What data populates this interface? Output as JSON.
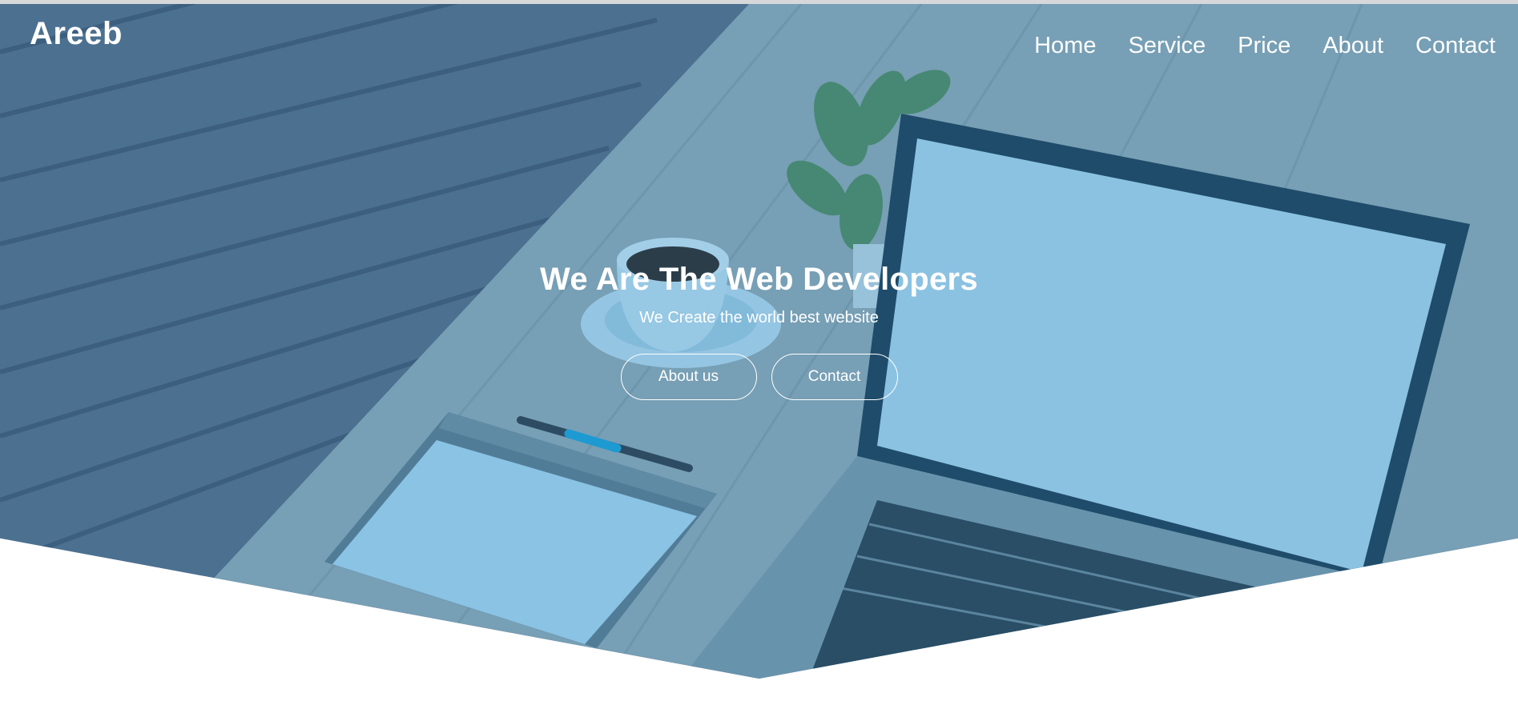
{
  "brand": {
    "logo_text": "Areeb"
  },
  "nav": {
    "items": [
      {
        "label": "Home"
      },
      {
        "label": "Service"
      },
      {
        "label": "Price"
      },
      {
        "label": "About"
      },
      {
        "label": "Contact"
      }
    ]
  },
  "hero": {
    "headline": "We Are The Web Developers",
    "subheadline": "We Create the world best website",
    "buttons": {
      "about_label": "About us",
      "contact_label": "Contact"
    }
  },
  "colors": {
    "overlay_tint": "#2882be",
    "text": "#ffffff",
    "page_background": "#ffffff"
  }
}
